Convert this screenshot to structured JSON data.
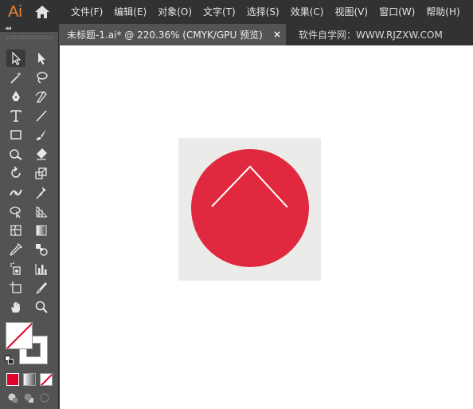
{
  "app": {
    "logo_text": "Ai",
    "accent_color": "#e8833a"
  },
  "menu": {
    "items": [
      {
        "label": "文件(F)"
      },
      {
        "label": "编辑(E)"
      },
      {
        "label": "对象(O)"
      },
      {
        "label": "文字(T)"
      },
      {
        "label": "选择(S)"
      },
      {
        "label": "效果(C)"
      },
      {
        "label": "视图(V)"
      },
      {
        "label": "窗口(W)"
      },
      {
        "label": "帮助(H)"
      }
    ]
  },
  "tabs": {
    "active_label": "未标题-1.ai* @ 220.36% (CMYK/GPU 预览)",
    "close_glyph": "×",
    "inactive_label": "软件自学网：WWW.RJZXW.COM"
  },
  "toolbar": {
    "collapse_glyph": "◂◂",
    "tools": [
      {
        "name": "selection-tool-icon"
      },
      {
        "name": "direct-selection-tool-icon"
      },
      {
        "name": "magic-wand-tool-icon"
      },
      {
        "name": "lasso-tool-icon"
      },
      {
        "name": "pen-tool-icon"
      },
      {
        "name": "curvature-tool-icon"
      },
      {
        "name": "type-tool-icon"
      },
      {
        "name": "line-segment-tool-icon"
      },
      {
        "name": "rectangle-tool-icon"
      },
      {
        "name": "paintbrush-tool-icon"
      },
      {
        "name": "shaper-tool-icon"
      },
      {
        "name": "eraser-tool-icon"
      },
      {
        "name": "rotate-tool-icon"
      },
      {
        "name": "scale-tool-icon"
      },
      {
        "name": "width-tool-icon"
      },
      {
        "name": "puppet-warp-tool-icon"
      },
      {
        "name": "shape-builder-tool-icon"
      },
      {
        "name": "perspective-grid-tool-icon"
      },
      {
        "name": "mesh-tool-icon"
      },
      {
        "name": "gradient-tool-icon"
      },
      {
        "name": "eyedropper-tool-icon"
      },
      {
        "name": "blend-tool-icon"
      },
      {
        "name": "symbol-sprayer-tool-icon"
      },
      {
        "name": "column-graph-tool-icon"
      },
      {
        "name": "artboard-tool-icon"
      },
      {
        "name": "slice-tool-icon"
      },
      {
        "name": "hand-tool-icon"
      },
      {
        "name": "zoom-tool-icon"
      }
    ],
    "swap_glyph": "⤾",
    "fill_color": "#ffffff",
    "stroke_color": "none",
    "mode_colors": [
      "#e0002a",
      "#d0d0d0",
      "#ffffff"
    ]
  },
  "artwork": {
    "background_color": "#ebebea",
    "circle_color": "#e0283e",
    "chevron_color": "#ffffff",
    "chevron_icon": "chevron-up-icon"
  }
}
